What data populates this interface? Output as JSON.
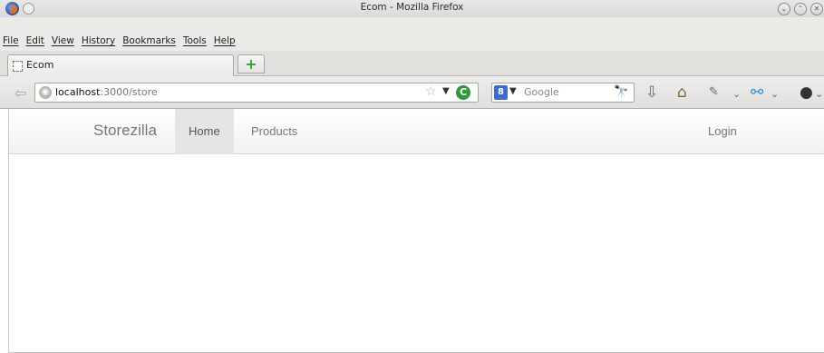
{
  "window": {
    "title": "Ecom - Mozilla Firefox",
    "minimize_glyph": "⌄",
    "maximize_glyph": "⌃",
    "close_glyph": "✕"
  },
  "menu": {
    "items": [
      "File",
      "Edit",
      "View",
      "History",
      "Bookmarks",
      "Tools",
      "Help"
    ]
  },
  "tabs": {
    "active_label": "Ecom",
    "new_tab_glyph": "+"
  },
  "navbar": {
    "url_host": "localhost",
    "url_path": ":3000/store",
    "search_engine": "8",
    "search_placeholder": "Google",
    "star_glyph": "☆",
    "reload_glyph": "C"
  },
  "site": {
    "brand": "Storezilla",
    "nav": [
      "Home",
      "Products"
    ],
    "active_nav": "Home",
    "login": "Login"
  },
  "colors": {
    "brand_text": "#777777",
    "active_nav_bg": "#e5e5e5",
    "reload_green": "#2f9a3a",
    "new_tab_green": "#3aa035"
  }
}
